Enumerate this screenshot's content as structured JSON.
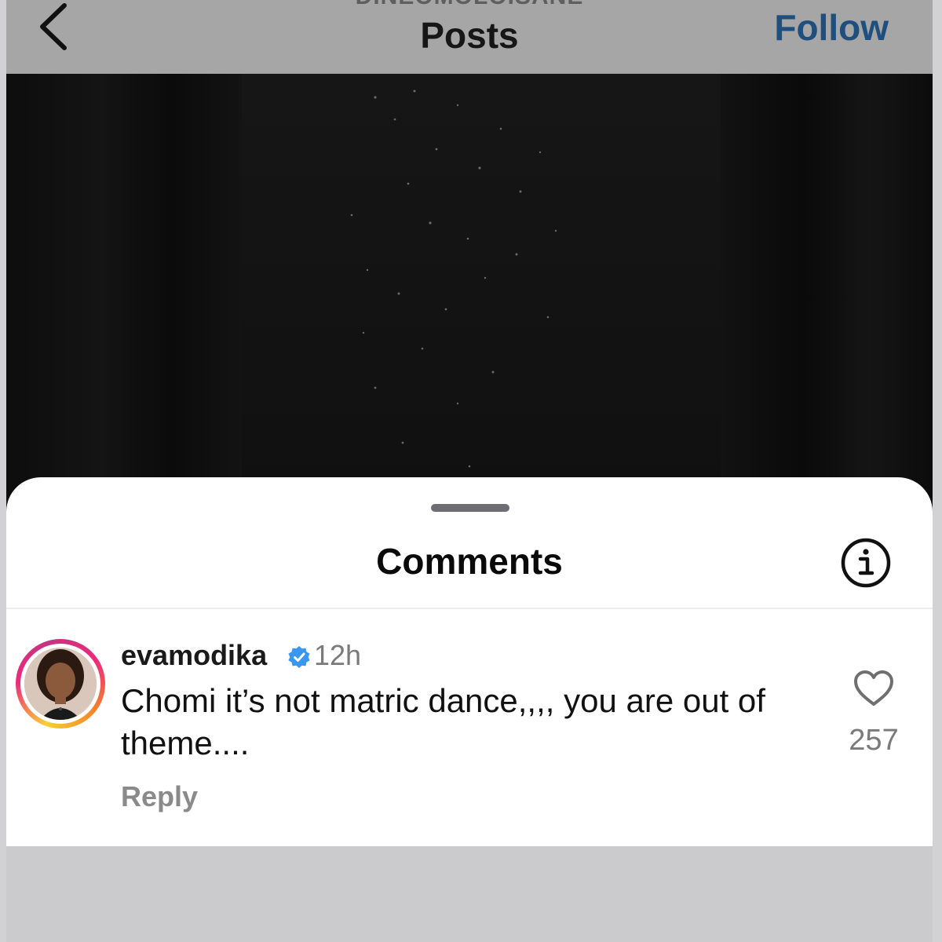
{
  "header": {
    "username": "DINEOMOLOISANE",
    "title": "Posts",
    "follow_label": "Follow",
    "back_icon": "chevron-left-icon"
  },
  "sheet": {
    "title": "Comments",
    "info_icon": "info-icon"
  },
  "comment": {
    "username": "evamodika",
    "verified_icon": "verified-badge-icon",
    "timestamp": "12h",
    "text": "Chomi it’s not matric dance,,,, you are out of theme....",
    "reply_label": "Reply",
    "like_icon": "heart-outline-icon",
    "like_count": "257"
  },
  "colors": {
    "follow": "#1f4f7e",
    "verified": "#3897f0",
    "header_bg": "#a6a6a6",
    "sheet_bg": "#ffffff"
  }
}
